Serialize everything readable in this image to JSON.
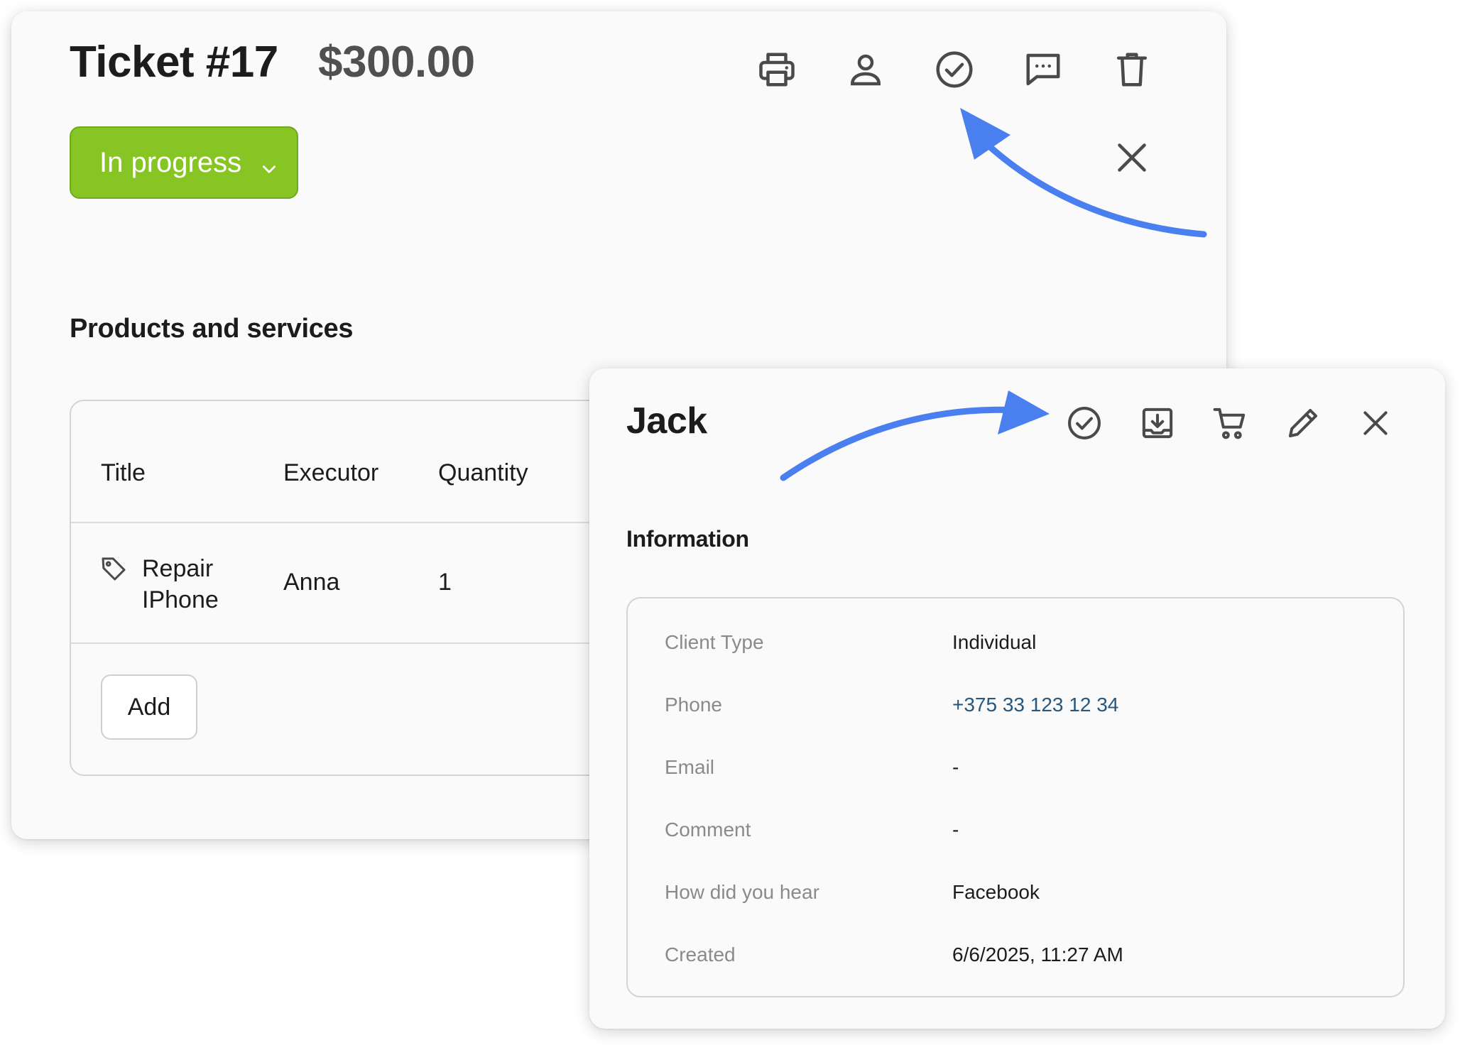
{
  "ticket": {
    "title": "Ticket #17",
    "price": "$300.00",
    "status_label": "In progress",
    "section_title": "Products and services",
    "icons": [
      "printer-icon",
      "person-icon",
      "check-circle-icon",
      "comment-icon",
      "trash-icon",
      "close-icon"
    ],
    "table": {
      "columns": [
        "Title",
        "Executor",
        "Quantity"
      ],
      "rows": [
        {
          "title_line1": "Repair",
          "title_line2": "IPhone",
          "executor": "Anna",
          "quantity": "1"
        }
      ],
      "add_label": "Add"
    }
  },
  "client": {
    "name": "Jack",
    "section_title": "Information",
    "icons": [
      "check-circle-icon",
      "download-icon",
      "cart-icon",
      "pencil-icon",
      "close-icon"
    ],
    "fields": [
      {
        "label": "Client Type",
        "value": "Individual"
      },
      {
        "label": "Phone",
        "value": "+375 33 123 12 34"
      },
      {
        "label": "Email",
        "value": "-"
      },
      {
        "label": "Comment",
        "value": "-"
      },
      {
        "label": "How did you hear",
        "value": "Facebook"
      },
      {
        "label": "Created",
        "value": "6/6/2025, 11:27 AM"
      }
    ]
  },
  "colors": {
    "status_green": "#86c524",
    "arrow_blue": "#4a7ff0",
    "phone_link": "#25577f",
    "icon_gray": "#4a4a4a"
  }
}
